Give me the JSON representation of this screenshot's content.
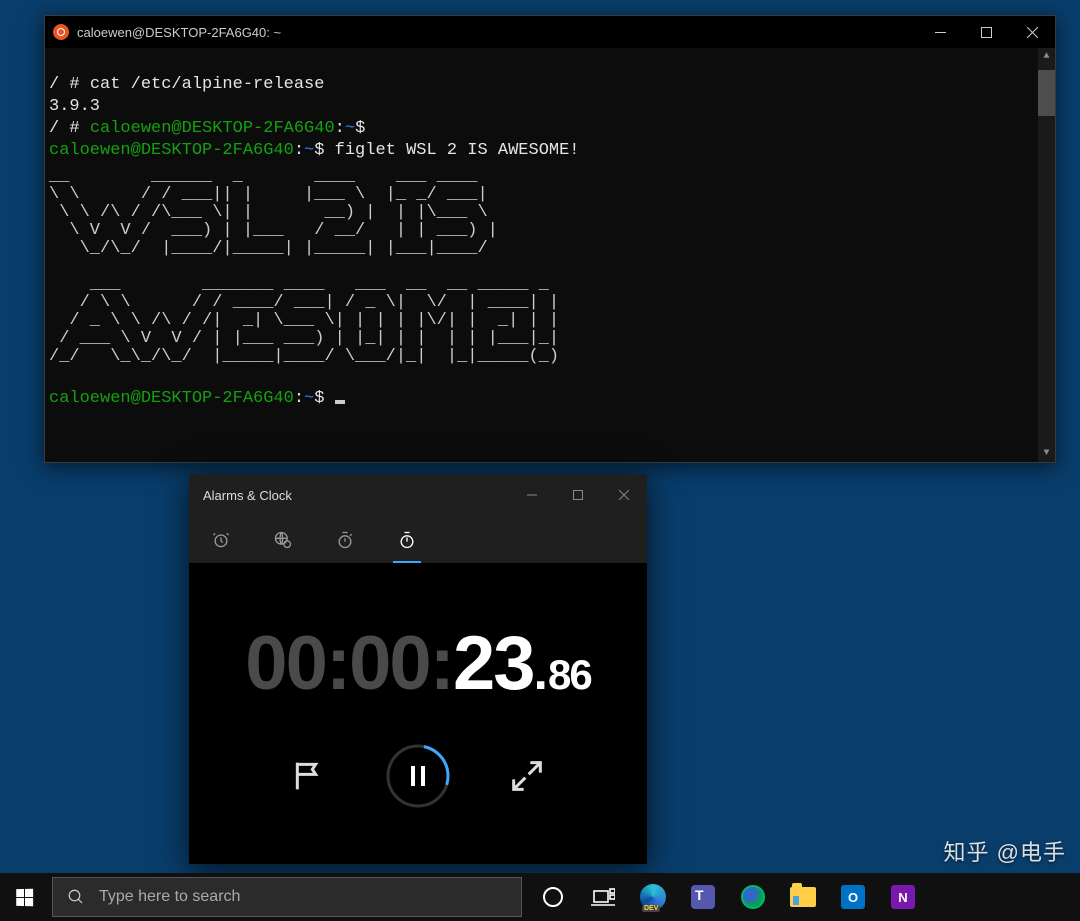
{
  "terminal": {
    "title": "caloewen@DESKTOP-2FA6G40: ~",
    "lines": {
      "l1_prompt": "/ # ",
      "l1_cmd": "cat /etc/alpine-release",
      "l2": "3.9.3",
      "l3_prompt": "/ # ",
      "l3_user": "caloewen@DESKTOP-2FA6G40",
      "l3_sep": ":",
      "l3_path": "~",
      "l3_dollar": "$",
      "l4_user": "caloewen@DESKTOP-2FA6G40",
      "l4_sep": ":",
      "l4_path": "~",
      "l4_dollar": "$ ",
      "l4_cmd": "figlet WSL 2 IS AWESOME!",
      "l_last_user": "caloewen@DESKTOP-2FA6G40",
      "l_last_sep": ":",
      "l_last_path": "~",
      "l_last_dollar": "$ "
    },
    "ascii_art": "__        ______  _       ____    ___ ____\n\\ \\      / / ___|| |     |___ \\  |_ _/ ___|\n \\ \\ /\\ / /\\___ \\| |       __) |  | |\\___ \\\n  \\ V  V /  ___) | |___   / __/   | | ___) |\n   \\_/\\_/  |____/|_____| |_____| |___|____/\n\n    ___        _______ ____   ___  __  __ _____ _\n   / \\ \\      / / ____/ ___| / _ \\|  \\/  | ____| |\n  / _ \\ \\ /\\ / /|  _| \\___ \\| | | | |\\/| |  _| | |\n / ___ \\ V  V / | |___ ___) | |_| | |  | | |___|_|\n/_/   \\_\\_/\\_/  |_____|____/ \\___/|_|  |_|_____(_)"
  },
  "clock": {
    "title": "Alarms & Clock",
    "time_hm": "00:00:",
    "time_s": "23",
    "time_dot": ".",
    "time_frac": "86"
  },
  "taskbar": {
    "search_placeholder": "Type here to search"
  },
  "watermark": "知乎 @电手"
}
